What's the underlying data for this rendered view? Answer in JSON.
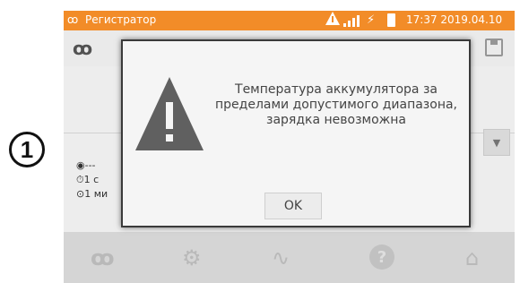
{
  "callout": {
    "label": "1"
  },
  "statusbar": {
    "app_icon": "recorder-icon",
    "title": "Регистратор",
    "datetime": "17:37 2019.04.10"
  },
  "content": {
    "line1": "◉---",
    "line2": "⏱1 с",
    "line3": "⊙1 ми"
  },
  "dialog": {
    "message": "Температура аккумулятора за пределами допустимого диапазона, зарядка невозможна",
    "ok_label": "OK"
  },
  "navbar": {
    "icons": [
      "recorder-icon",
      "settings-icon",
      "waveform-icon",
      "help-icon",
      "home-icon"
    ],
    "help_glyph": "?"
  },
  "colors": {
    "accent": "#f28c28",
    "dialog_border": "#3a3a3a",
    "warning_triangle": "#606060"
  }
}
